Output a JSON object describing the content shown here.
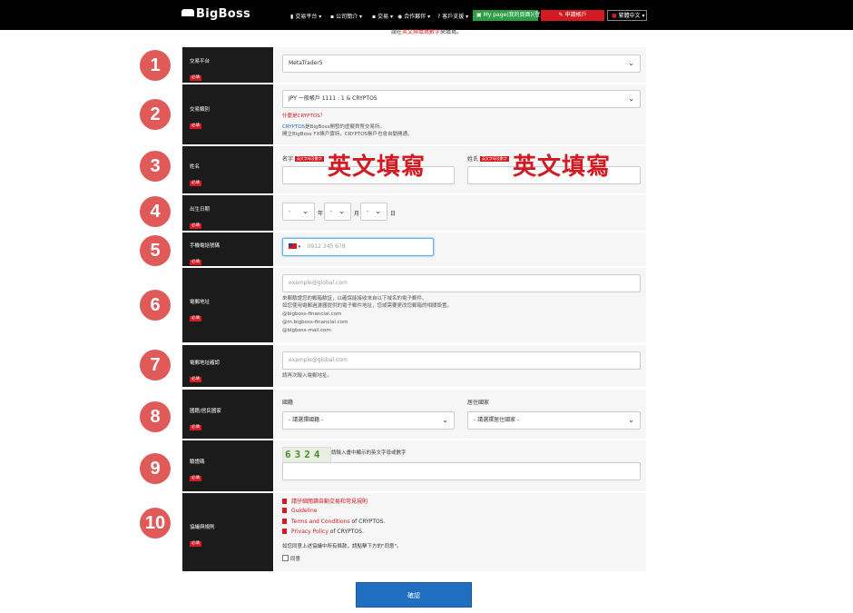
{
  "nav": {
    "logo": "BigBoss",
    "items": [
      "交易平台",
      "公司簡介",
      "交易",
      "合作夥伴",
      "客戶支援"
    ],
    "mypage": "My page(我的頁面)(登入)",
    "open_account": "申請帳戶",
    "language": "繁體中文"
  },
  "notice": {
    "pre": "請在",
    "red": "英文與填寫數字",
    "post": "來填寫。"
  },
  "steps": [
    "1",
    "2",
    "3",
    "4",
    "5",
    "6",
    "7",
    "8",
    "9",
    "10"
  ],
  "rows": {
    "platform": {
      "label": "交易平台",
      "required": "必填",
      "value": "MetaTrader5"
    },
    "account_type": {
      "label": "交易類別",
      "required": "必填",
      "value": "JPY 一般帳戶 1111 : 1 & CRYPTOS",
      "link": "什麼是CRYPTOS？",
      "line1_a": "CRYPTOS",
      "line1_b": "是BigBoss開發的虛擬貨幣交易所。",
      "line2": "開立BigBoss FX帳戶實時，CRYPTOS帳戶也會自動開通。"
    },
    "name": {
      "label": "姓名",
      "required": "必填",
      "first_label": "名字",
      "last_label": "姓氏",
      "tag": "英文字母及數字",
      "overlay": "英文填寫"
    },
    "dob": {
      "label": "出生日期",
      "required": "必填",
      "year": "年",
      "month": "月",
      "day": "日",
      "dash": "-"
    },
    "phone": {
      "label": "手機電話號碼",
      "required": "必填",
      "placeholder": "0912 345 678"
    },
    "email": {
      "label": "電郵地址",
      "required": "必填",
      "placeholder": "example@global.com",
      "notes": [
        "來郵驗證您的郵箱驗証，以確保能接收來自以下域名的電子郵件。",
        "如您使用電郵過濾器提供的電子郵件地址，您或需要更改您郵箱的相關設置。",
        "@bigboss-financial.com",
        "@m.bigboss-financial.com",
        "@bigboss-mail.com"
      ]
    },
    "email_confirm": {
      "label": "電郵地址確認",
      "required": "必填",
      "placeholder": "example@global.com",
      "note": "請再次輸入電郵地址。"
    },
    "nationality": {
      "label": "國籍/居民國家",
      "required": "必填",
      "nat_label": "國籍",
      "res_label": "居住國家",
      "nat_value": "- 請選擇國籍 -",
      "res_value": "- 請選擇居住國家 -"
    },
    "captcha": {
      "label": "驗證碼",
      "required": "必填",
      "code": "6324",
      "hint": "請輸入畫中顯示的英文字母或數字"
    },
    "agreements": {
      "label": "協議與規則",
      "required": "必填",
      "docs": [
        {
          "link": "請仔細閱讀自動交易和常見規則",
          "suffix": ""
        },
        {
          "link": "Guideline",
          "suffix": ""
        },
        {
          "link": "Terms and Conditions",
          "suffix": " of CRYPTOS."
        },
        {
          "link": "Privacy Policy",
          "suffix": " of CRYPTOS."
        }
      ],
      "note": "如您同意上述協議中所有條款，請點擊下方的\"同意\"。",
      "agree": "同意"
    }
  },
  "submit": "確認",
  "colors": {
    "accent": "#d21a22",
    "button": "#1f6ebf",
    "label_bg": "#1b1b1b",
    "step_circle": "#e05a5a"
  }
}
